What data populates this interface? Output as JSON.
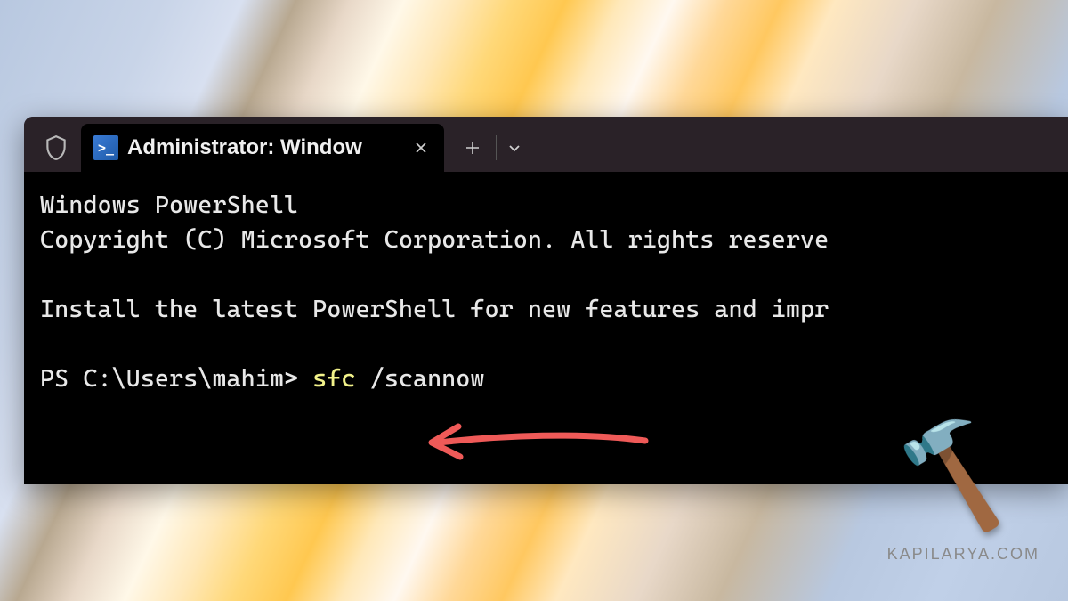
{
  "tab": {
    "title": "Administrator: Window",
    "icon_label": ">_"
  },
  "terminal": {
    "line1": "Windows PowerShell",
    "line2": "Copyright (C) Microsoft Corporation. All rights reserve",
    "line3": "",
    "line4": "Install the latest PowerShell for new features and impr",
    "line5": "",
    "prompt": "PS C:\\Users\\mahim> ",
    "cmd_bin": "sfc",
    "cmd_args": " /scannow"
  },
  "watermark": "KAPILARYA.COM"
}
